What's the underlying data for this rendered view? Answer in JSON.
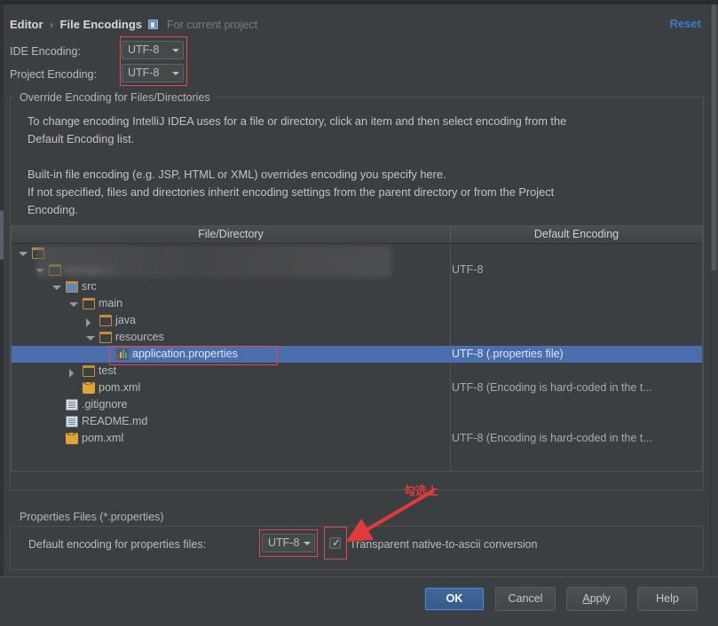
{
  "header": {
    "crumb_root": "Editor",
    "crumb_sep": "›",
    "crumb_current": "File Encodings",
    "scope_note": "For current project",
    "scope_icon": "project-icon",
    "reset_label": "Reset"
  },
  "encoding_fields": {
    "ide_label": "IDE Encoding:",
    "ide_value": "UTF-8",
    "project_label": "Project Encoding:",
    "project_value": "UTF-8"
  },
  "override_group": {
    "title": "Override Encoding for Files/Directories",
    "paragraph1": "To change encoding IntelliJ IDEA uses for a file or directory, click an item and then select encoding from the",
    "paragraph2": "Default Encoding list.",
    "paragraph3": "Built-in file encoding (e.g. JSP, HTML or XML) overrides encoding you specify here.",
    "paragraph4": "If not specified, files and directories inherit encoding settings from the parent directory or from the Project",
    "paragraph5": "Encoding."
  },
  "table": {
    "columns": [
      "File/Directory",
      "Default Encoding"
    ],
    "rows": [
      {
        "name": "",
        "indent": 0,
        "twisty": "down",
        "icon": "folder",
        "encoding": "",
        "selected": false,
        "redacted": true
      },
      {
        "name": "springboo",
        "indent": 1,
        "twisty": "down",
        "icon": "folder",
        "encoding": "UTF-8",
        "selected": false,
        "redacted": true
      },
      {
        "name": "src",
        "indent": 2,
        "twisty": "down",
        "icon": "folder-src",
        "encoding": "",
        "selected": false,
        "redacted": false
      },
      {
        "name": "main",
        "indent": 3,
        "twisty": "down",
        "icon": "folder",
        "encoding": "",
        "selected": false,
        "redacted": false
      },
      {
        "name": "java",
        "indent": 4,
        "twisty": "right",
        "icon": "folder",
        "encoding": "",
        "selected": false,
        "redacted": false
      },
      {
        "name": "resources",
        "indent": 4,
        "twisty": "down",
        "icon": "folder",
        "encoding": "",
        "selected": false,
        "redacted": false
      },
      {
        "name": "application.properties",
        "indent": 5,
        "twisty": "none",
        "icon": "properties-file",
        "encoding": "UTF-8 (.properties file)",
        "selected": true,
        "redacted": false
      },
      {
        "name": "test",
        "indent": 3,
        "twisty": "right",
        "icon": "folder",
        "encoding": "",
        "selected": false,
        "redacted": false
      },
      {
        "name": "pom.xml",
        "indent": 3,
        "twisty": "none",
        "icon": "xml-file",
        "encoding": "UTF-8 (Encoding is hard-coded in the t...",
        "selected": false,
        "redacted": false
      },
      {
        "name": ".gitignore",
        "indent": 2,
        "twisty": "none",
        "icon": "text-file",
        "encoding": "",
        "selected": false,
        "redacted": false
      },
      {
        "name": "README.md",
        "indent": 2,
        "twisty": "none",
        "icon": "text-file",
        "encoding": "",
        "selected": false,
        "redacted": false
      },
      {
        "name": "pom.xml",
        "indent": 2,
        "twisty": "none",
        "icon": "xml-file",
        "encoding": "UTF-8 (Encoding is hard-coded in the t...",
        "selected": false,
        "redacted": false
      }
    ]
  },
  "properties_group": {
    "title": "Properties Files (*.properties)",
    "default_encoding_label": "Default encoding for properties files:",
    "default_encoding_value": "UTF-8",
    "checkbox_label": "Transparent native-to-ascii conversion",
    "checkbox_checked": true
  },
  "annotation": {
    "text": "勾选上",
    "color": "#e03b3b"
  },
  "buttons": {
    "ok": "OK",
    "cancel": "Cancel",
    "apply_pre": "A",
    "apply_post": "pply",
    "help": "Help"
  },
  "colors": {
    "background": "#3c3f41",
    "selection": "#4b6eaf",
    "link": "#3a7cc7",
    "annotation": "#e03b3b"
  }
}
